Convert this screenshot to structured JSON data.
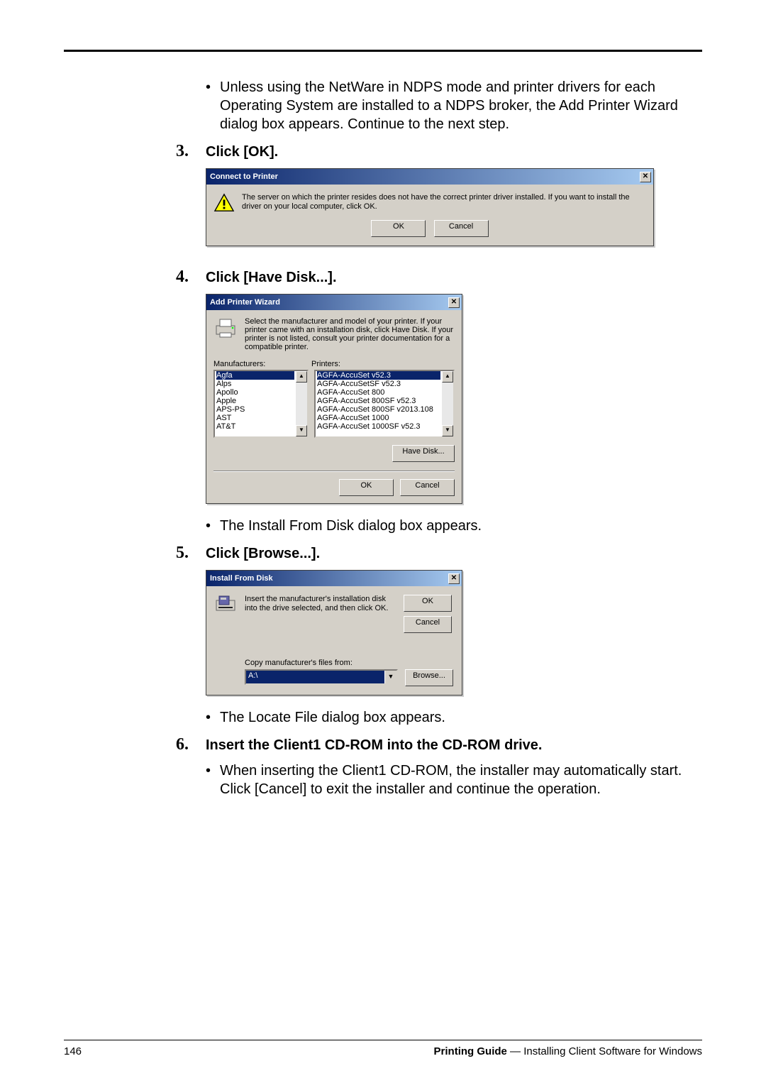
{
  "intro_bullet": "Unless using the NetWare in NDPS mode and printer drivers for each Operating System are installed to a NDPS broker, the Add Printer Wizard dialog box appears. Continue to the next step.",
  "step3": {
    "num": "3.",
    "label": "Click [OK]."
  },
  "dlg_connect": {
    "title": "Connect to Printer",
    "msg": "The server on which the printer resides does not have the correct printer driver installed. If you want to install the driver on your local computer, click OK.",
    "ok": "OK",
    "cancel": "Cancel"
  },
  "step4": {
    "num": "4.",
    "label": "Click [Have Disk...]."
  },
  "dlg_addprinter": {
    "title": "Add Printer Wizard",
    "instruction": "Select the manufacturer and model of your printer. If your printer came with an installation disk, click Have Disk. If your printer is not listed, consult your printer documentation for a compatible printer.",
    "manufacturers_label": "Manufacturers:",
    "printers_label": "Printers:",
    "manufacturers": [
      "Agfa",
      "Alps",
      "Apollo",
      "Apple",
      "APS-PS",
      "AST",
      "AT&T"
    ],
    "printers": [
      "AGFA-AccuSet v52.3",
      "AGFA-AccuSetSF v52.3",
      "AGFA-AccuSet 800",
      "AGFA-AccuSet 800SF v52.3",
      "AGFA-AccuSet 800SF v2013.108",
      "AGFA-AccuSet 1000",
      "AGFA-AccuSet 1000SF v52.3"
    ],
    "have_disk": "Have Disk...",
    "ok": "OK",
    "cancel": "Cancel"
  },
  "bullet_install_from_disk": "The Install From Disk dialog box appears.",
  "step5": {
    "num": "5.",
    "label": "Click [Browse...]."
  },
  "dlg_installfromdisk": {
    "title": "Install From Disk",
    "msg": "Insert the manufacturer's installation disk into the drive selected, and then click OK.",
    "copy_label": "Copy manufacturer's files from:",
    "path": "A:\\",
    "ok": "OK",
    "cancel": "Cancel",
    "browse": "Browse..."
  },
  "bullet_locate_file": "The Locate File dialog box appears.",
  "step6": {
    "num": "6.",
    "label": "Insert the Client1 CD-ROM into the CD-ROM drive."
  },
  "bullet_cdrom": "When inserting the Client1 CD-ROM, the installer may automatically start. Click [Cancel] to exit the installer and continue the operation.",
  "footer": {
    "page": "146",
    "right_bold": "Printing Guide",
    "right_rest": " — Installing Client Software for Windows"
  }
}
